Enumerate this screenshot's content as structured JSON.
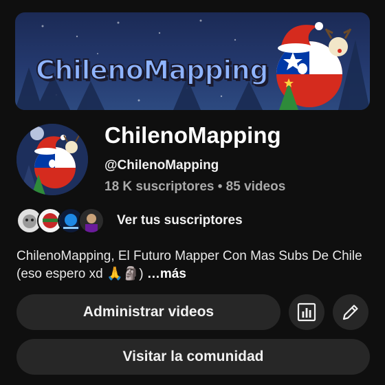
{
  "banner": {
    "title": "ChilenoMapping"
  },
  "channel": {
    "name": "ChilenoMapping",
    "handle": "@ChilenoMapping",
    "stats": "18 K suscriptores • 85 videos"
  },
  "subscribers": {
    "label": "Ver tus suscriptores"
  },
  "description": {
    "text": "ChilenoMapping, El Futuro Mapper Con Mas Subs De Chile (eso espero xd 🙏🗿)",
    "more": "…más"
  },
  "buttons": {
    "manage_videos": "Administrar videos",
    "visit_community": "Visitar la comunidad",
    "stats_icon": "bar-chart-icon",
    "edit_icon": "pencil-icon"
  },
  "colors": {
    "background": "#0f0f0f",
    "button": "#272727",
    "secondary_text": "#aaaaaa"
  }
}
